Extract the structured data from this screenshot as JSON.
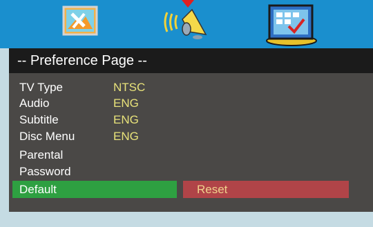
{
  "header": {
    "tabs": [
      {
        "icon": "general-setup-icon",
        "selected": false
      },
      {
        "icon": "audio-setup-icon",
        "selected": false
      },
      {
        "icon": "preference-setup-icon",
        "selected": true
      }
    ]
  },
  "title": "-- Preference Page --",
  "settings": [
    {
      "label": "TV Type",
      "value": "NTSC"
    },
    {
      "label": "Audio",
      "value": "ENG"
    },
    {
      "label": "Subtitle",
      "value": "ENG"
    },
    {
      "label": "Disc Menu",
      "value": "ENG"
    },
    {
      "label": "Parental",
      "value": ""
    },
    {
      "label": "Password",
      "value": ""
    }
  ],
  "default_item": {
    "label": "Default",
    "option": "Reset"
  },
  "colors": {
    "header_bg": "#1a8fce",
    "title_bg": "#1b1b1b",
    "panel_bg": "#4a4846",
    "value_text": "#e8e27a",
    "selected_bg": "#2ea041",
    "reset_bg": "#b04448",
    "page_bg": "#c5dbe3"
  }
}
